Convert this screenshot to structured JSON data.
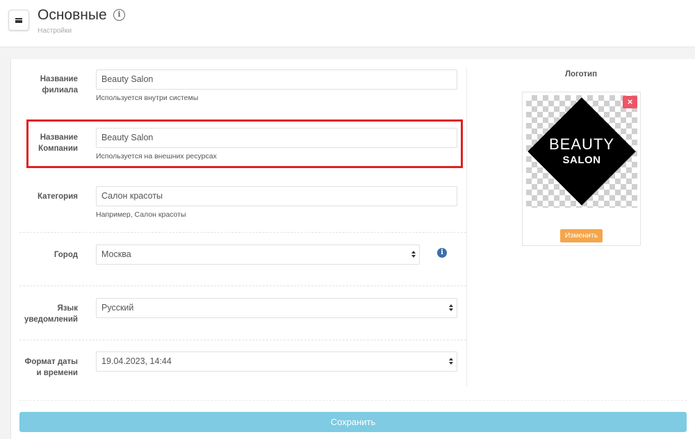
{
  "header": {
    "title": "Основные",
    "subtitle": "Настройки"
  },
  "form": {
    "branch_name": {
      "label": "Название филиала",
      "value": "Beauty Salon",
      "help": "Используется внутри системы"
    },
    "company_name": {
      "label": "Название Компании",
      "value": "Beauty Salon",
      "help": "Используется на внешних ресурсах"
    },
    "category": {
      "label": "Категория",
      "value": "Салон красоты",
      "help": "Например, Салон красоты"
    },
    "city": {
      "label": "Город",
      "value": "Москва"
    },
    "notify_lang": {
      "label": "Язык уведомлений",
      "value": "Русский"
    },
    "date_format": {
      "label": "Формат даты и времени",
      "value": "19.04.2023, 14:44"
    }
  },
  "logo": {
    "title": "Логотип",
    "text_top": "BEAUTY",
    "text_bottom": "SALON",
    "delete_label": "×",
    "change_label": "Изменить"
  },
  "actions": {
    "save_label": "Сохранить"
  },
  "colors": {
    "highlight": "#e02020",
    "save_button": "#7ecbe3",
    "change_button": "#f4a64c",
    "delete_button": "#ed5565",
    "info_icon": "#3c6ea8"
  }
}
